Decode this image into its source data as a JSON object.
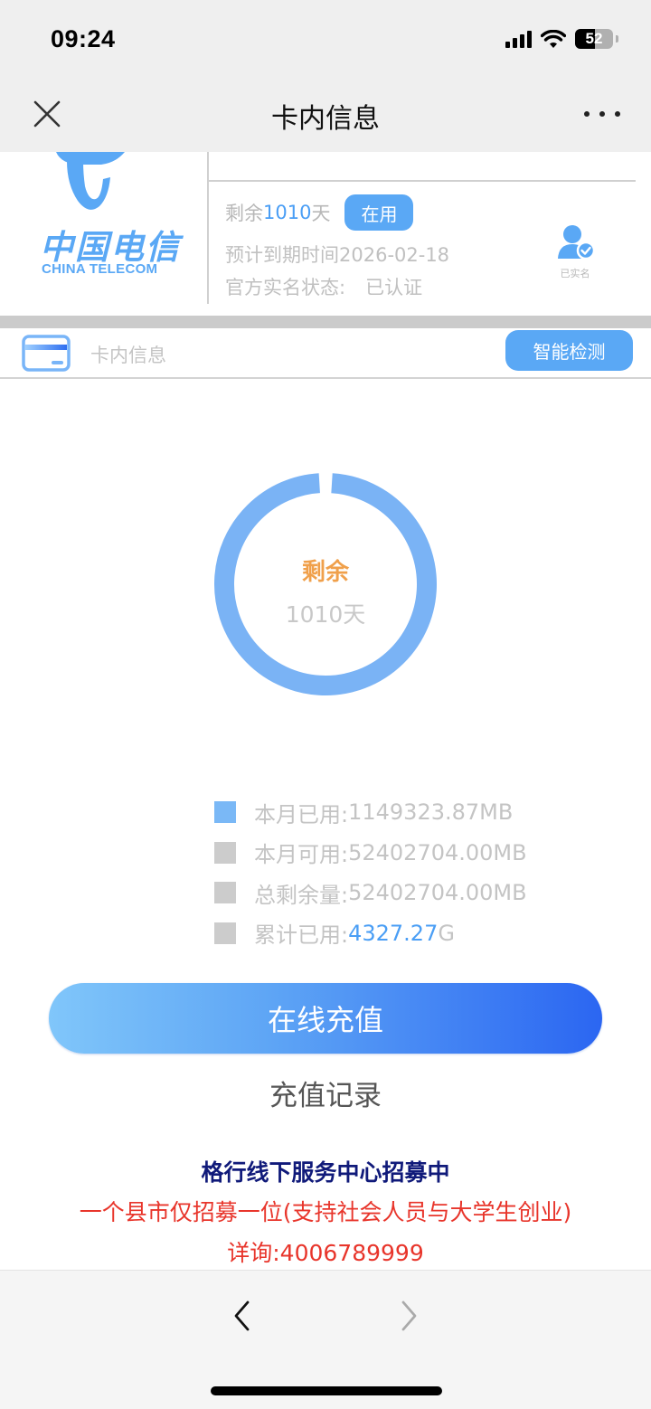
{
  "status_bar": {
    "time": "09:24",
    "battery_level": "52",
    "battery_fraction": 0.52,
    "icons": [
      "signal-icon",
      "wifi-icon",
      "battery-icon"
    ]
  },
  "nav": {
    "title": "卡内信息",
    "close_icon": "close-icon",
    "more_icon": "more-icon"
  },
  "card": {
    "logo_cn": "中国电信",
    "logo_en": "CHINA TELECOM",
    "remain_prefix": "剩余",
    "remain_days": "1010",
    "remain_suffix": "天",
    "status_badge": "在用",
    "expire_label": "预计到期时间2026-02-18",
    "realname_label": "官方实名状态:",
    "realname_value": "已认证",
    "verified_label": "已实名",
    "brand_color": "#5aa8f5"
  },
  "section": {
    "title": "卡内信息",
    "detect_button": "智能检测"
  },
  "ring": {
    "label": "剩余",
    "value": "1010天",
    "remaining_fraction": 0.98,
    "color": "#7ab3f5"
  },
  "legend": {
    "items": [
      {
        "label": "本月已用:",
        "value": "1149323.87MB",
        "color": "#7ab8f6",
        "highlight": ""
      },
      {
        "label": "本月可用:",
        "value": "52402704.00MB",
        "color": "#cccccc",
        "highlight": ""
      },
      {
        "label": "总剩余量:",
        "value": "52402704.00MB",
        "color": "#cccccc",
        "highlight": ""
      },
      {
        "label": "累计已用:",
        "value": "G",
        "color": "#cccccc",
        "highlight": "4327.27"
      }
    ]
  },
  "actions": {
    "recharge_button": "在线充值",
    "history_link": "充值记录"
  },
  "promo": {
    "title": "格行线下服务中心招募中",
    "subtitle": "一个县市仅招募一位(支持社会人员与大学生创业)",
    "contact": "详询:4006789999"
  },
  "bottom_bar": {
    "back_icon": "chevron-left-icon",
    "forward_icon": "chevron-right-icon"
  }
}
